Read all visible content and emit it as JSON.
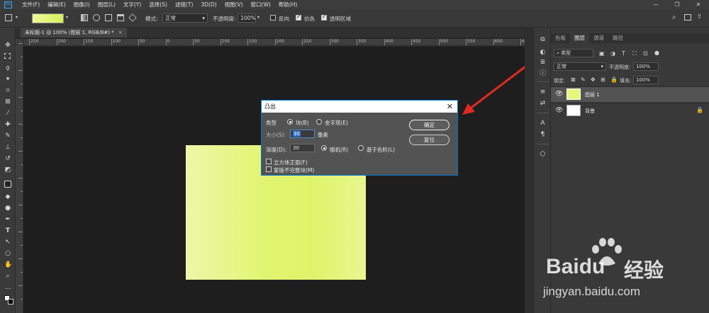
{
  "app": {
    "logo_text": "Ps",
    "menu": [
      "文件(F)",
      "编辑(E)",
      "图像(I)",
      "图层(L)",
      "文字(Y)",
      "选择(S)",
      "滤镜(T)",
      "3D(D)",
      "视图(V)",
      "窗口(W)",
      "帮助(H)"
    ],
    "window_controls": [
      "—",
      "❐",
      "✕"
    ]
  },
  "options_bar": {
    "mode_label": "模式:",
    "mode_value": "正常",
    "opacity_label": "不透明度:",
    "opacity_value": "100%",
    "reverse_label": "反向",
    "reverse_checked": false,
    "dither_label": "仿色",
    "dither_checked": true,
    "transparency_label": "透明区域",
    "transparency_checked": true,
    "gradient_colors": [
      "#eefa9a",
      "#d6f05a"
    ],
    "right_icons": [
      "search-icon",
      "workspace-icon",
      "share-icon"
    ]
  },
  "document": {
    "tab_title": "未标题-1 @ 100% (图层 1, RGB/8#) *",
    "tab_close": "×",
    "ruler_labels": [
      "250",
      "200",
      "150",
      "100",
      "50",
      "0",
      "50",
      "100",
      "150",
      "200",
      "250",
      "300",
      "350",
      "400",
      "450",
      "500",
      "550",
      "600",
      "650"
    ]
  },
  "tools": [
    "move-tool-icon",
    "marquee-tool-icon",
    "lasso-tool-icon",
    "magic-wand-tool-icon",
    "crop-tool-icon",
    "frame-tool-icon",
    "eyedropper-tool-icon",
    "healing-brush-tool-icon",
    "brush-tool-icon",
    "clone-stamp-tool-icon",
    "history-brush-tool-icon",
    "eraser-tool-icon",
    "gradient-tool-icon",
    "blur-tool-icon",
    "dodge-tool-icon",
    "pen-tool-icon",
    "type-tool-icon",
    "path-selection-tool-icon",
    "ellipse-tool-icon",
    "hand-tool-icon",
    "zoom-tool-icon",
    "more-tools-icon"
  ],
  "dialog": {
    "title": "凸出",
    "close": "✕",
    "type_label": "类型",
    "type_block": "块(B)",
    "type_pyramid": "金字塔(E)",
    "type_selected": "block",
    "size_label": "大小(S):",
    "size_value": "30",
    "size_unit": "像素",
    "depth_label": "深度(D):",
    "depth_value": "30",
    "depth_random": "随机(R)",
    "depth_level": "基于色阶(L)",
    "depth_selected": "random",
    "solid_front": "立方体正面(F)",
    "solid_front_checked": false,
    "mask_incomplete": "蒙版不完整块(M)",
    "mask_incomplete_checked": false,
    "ok": "确定",
    "reset": "复位"
  },
  "layers_panel": {
    "tabs": [
      "色板",
      "图层",
      "通道",
      "路径"
    ],
    "active_tab": "图层",
    "filter_kind": "类型",
    "blend_mode": "正常",
    "opacity_label": "不透明度:",
    "opacity_value": "100%",
    "lock_label": "锁定:",
    "fill_label": "填充:",
    "fill_value": "100%",
    "layers": [
      {
        "name": "图层 1",
        "selected": true,
        "thumb_color": "#e4f77c"
      },
      {
        "name": "背景",
        "selected": false,
        "thumb_color": "#ffffff",
        "locked": true
      }
    ]
  },
  "watermark": {
    "brand": "Bai",
    "brand_suffix": "du",
    "jingyan": "经验",
    "url": "jingyan.baidu.com"
  },
  "colors": {
    "accent_blue": "#0078d7",
    "arrow_red": "#e02a20",
    "selection_blue": "#2f6fd0"
  }
}
